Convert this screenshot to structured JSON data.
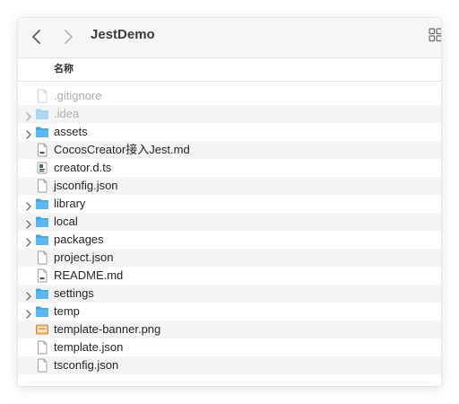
{
  "window": {
    "title": "JestDemo",
    "back_icon": "chevron-left-icon",
    "forward_icon": "chevron-right-icon",
    "view_icon": "grid-view-icon"
  },
  "header": {
    "name_column": "名称"
  },
  "files": [
    {
      "name": ".gitignore",
      "kind": "file",
      "expandable": false,
      "dimmed": true
    },
    {
      "name": ".idea",
      "kind": "folder",
      "expandable": true,
      "dimmed": true
    },
    {
      "name": "assets",
      "kind": "folder",
      "expandable": true,
      "dimmed": false
    },
    {
      "name": "CocosCreator接入Jest.md",
      "kind": "markdown",
      "expandable": false,
      "dimmed": false
    },
    {
      "name": "creator.d.ts",
      "kind": "typescript",
      "expandable": false,
      "dimmed": false
    },
    {
      "name": "jsconfig.json",
      "kind": "file",
      "expandable": false,
      "dimmed": false
    },
    {
      "name": "library",
      "kind": "folder",
      "expandable": true,
      "dimmed": false
    },
    {
      "name": "local",
      "kind": "folder",
      "expandable": true,
      "dimmed": false
    },
    {
      "name": "packages",
      "kind": "folder",
      "expandable": true,
      "dimmed": false
    },
    {
      "name": "project.json",
      "kind": "file",
      "expandable": false,
      "dimmed": false
    },
    {
      "name": "README.md",
      "kind": "markdown",
      "expandable": false,
      "dimmed": false
    },
    {
      "name": "settings",
      "kind": "folder",
      "expandable": true,
      "dimmed": false
    },
    {
      "name": "temp",
      "kind": "folder",
      "expandable": true,
      "dimmed": false
    },
    {
      "name": "template-banner.png",
      "kind": "image",
      "expandable": false,
      "dimmed": false
    },
    {
      "name": "template.json",
      "kind": "file",
      "expandable": false,
      "dimmed": false
    },
    {
      "name": "tsconfig.json",
      "kind": "file",
      "expandable": false,
      "dimmed": false
    }
  ],
  "colors": {
    "folder": "#5ab8f0",
    "folder_dark": "#3fa6e6",
    "text": "#262626",
    "dim_text": "#aeaeae",
    "alt_row": "#f4f4f5"
  }
}
